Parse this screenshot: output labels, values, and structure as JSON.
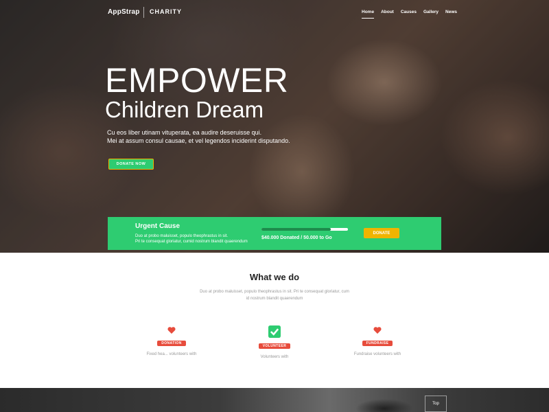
{
  "nav": {
    "brand": "AppStrap",
    "brand_sub": "CHARITY",
    "links": [
      "Home",
      "About",
      "Causes",
      "Gallery",
      "News"
    ]
  },
  "hero": {
    "title": "EMPOWER",
    "subtitle": "Children Dream",
    "desc_line1": "Cu eos liber utinam vituperata, ea audire deseruisse qui.",
    "desc_line2": "Mei at assum consul causae, et vel legendos inciderint disputando.",
    "button": "DONATE NOW"
  },
  "urgent": {
    "title": "Urgent Cause",
    "text_line1": "Duo at probo maluisset, populo theophrastus in sit.",
    "text_line2": "Pri te consequat gloriatur, cumid nostrum blandit quaerendum",
    "progress_label": "$40.000 Donated / 50.000 to Go",
    "progress": 0.8,
    "button": "DONATE"
  },
  "what_we_do": {
    "title": "What we do",
    "desc_line1": "Duo at probo maluisset, populo theophrastus in sit. Pri te consequat gloriatur, cum",
    "desc_line2": "id nostrum blandit quaerendum"
  },
  "features": [
    {
      "icon": "heart-icon",
      "label": "DONATION",
      "text": "Fixed hea... volunteers with"
    },
    {
      "icon": "check-icon",
      "label": "VOLUNTEER",
      "text": "Volunteers with"
    },
    {
      "icon": "heart-icon",
      "label": "FUNDRAISE",
      "text": "Fundraise volunteers with"
    }
  ],
  "colors": {
    "green": "#2ecc71",
    "red": "#e74c3c",
    "accent": "#f0b400"
  },
  "scroll_top": "Top"
}
